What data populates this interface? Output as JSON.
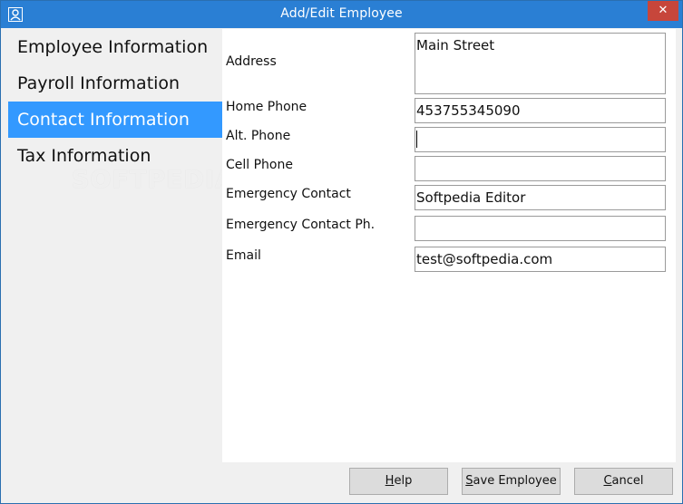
{
  "window": {
    "title": "Add/Edit Employee",
    "close_label": "✕",
    "icon": "user-icon"
  },
  "sidebar": {
    "items": [
      {
        "label": "Employee Information",
        "active": false
      },
      {
        "label": "Payroll Information",
        "active": false
      },
      {
        "label": "Contact Information",
        "active": true
      },
      {
        "label": "Tax Information",
        "active": false
      }
    ],
    "watermark": "SOFTPEDIA"
  },
  "form": {
    "fields": [
      {
        "label": "Address",
        "value": "Main Street"
      },
      {
        "label": "Home Phone",
        "value": "453755345090"
      },
      {
        "label": "Alt. Phone",
        "value": ""
      },
      {
        "label": "Cell Phone",
        "value": ""
      },
      {
        "label": "Emergency Contact",
        "value": "Softpedia Editor"
      },
      {
        "label": "Emergency Contact Ph.",
        "value": ""
      },
      {
        "label": "Email",
        "value": "test@softpedia.com"
      }
    ]
  },
  "buttons": {
    "help": {
      "first": "H",
      "rest": "elp"
    },
    "save": {
      "first": "S",
      "rest": "ave Employee"
    },
    "cancel": {
      "first": "C",
      "rest": "ancel"
    }
  },
  "colors": {
    "titlebar": "#2a7fd4",
    "selection": "#3399ff",
    "close": "#c7463b"
  }
}
